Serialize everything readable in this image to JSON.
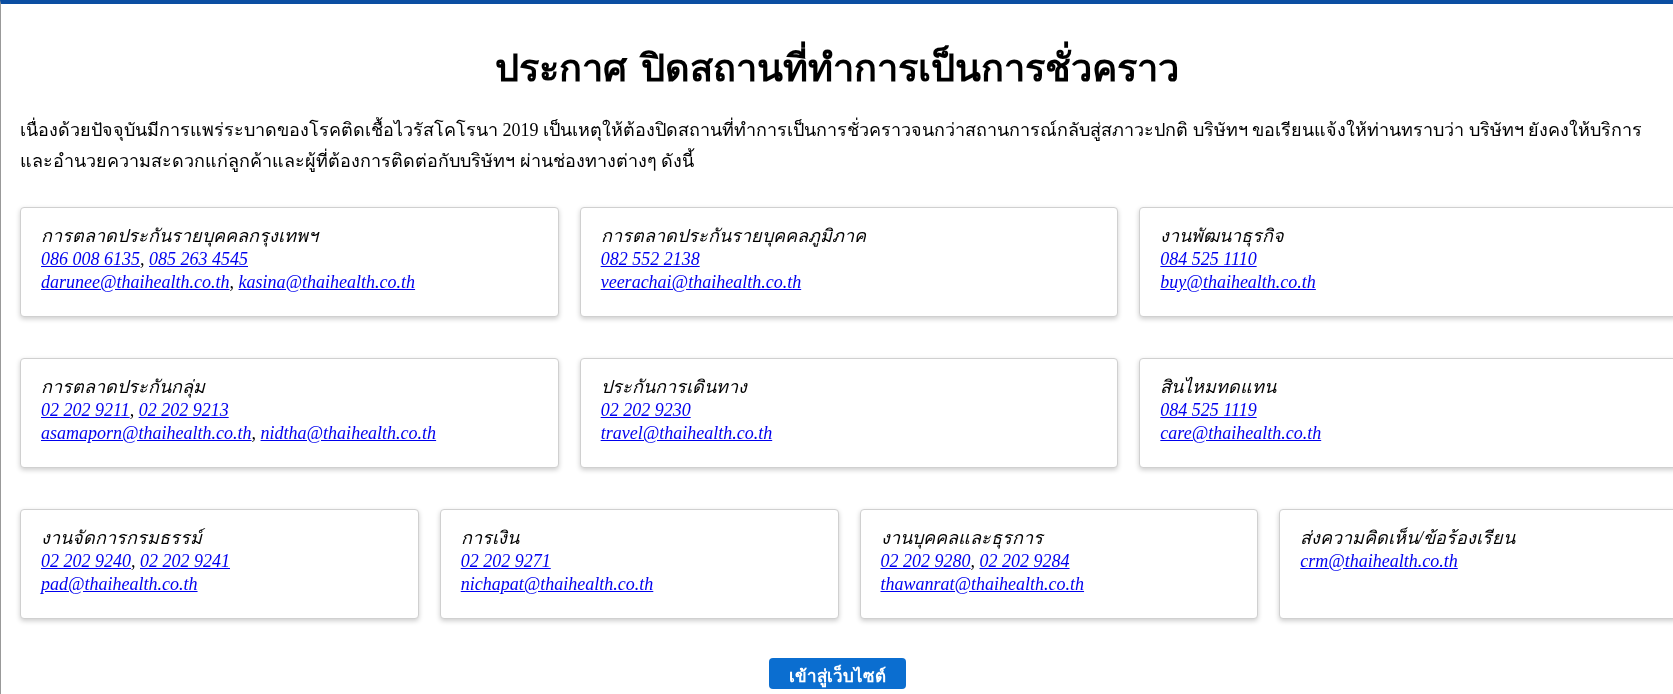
{
  "title": "ประกาศ ปิดสถานที่ทำการเป็นการชั่วคราว",
  "intro": "เนื่องด้วยปัจจุบันมีการแพร่ระบาดของโรคติดเชื้อไวรัสโคโรนา 2019 เป็นเหตุให้ต้องปิดสถานที่ทำการเป็นการชั่วคราวจนกว่าสถานการณ์กลับสู่สภาวะปกติ บริษัทฯ ขอเรียนแจ้งให้ท่านทราบว่า บริษัทฯ ยังคงให้บริการและอำนวยความสะดวกแก่ลูกค้าและผู้ที่ต้องการติดต่อกับบริษัทฯ ผ่านช่องทางต่างๆ ดังนี้",
  "card_rows": [
    [
      {
        "name": "การตลาดประกันรายบุคคลกรุงเทพฯ",
        "phones": [
          "086 008 6135",
          "085 263 4545"
        ],
        "phone_separator": ",",
        "emails": [
          "darunee@thaihealth.co.th",
          "kasina@thaihealth.co.th"
        ],
        "email_separator": ","
      },
      {
        "name": "การตลาดประกันรายบุคคลภูมิภาค",
        "phones": [
          "082 552 2138"
        ],
        "emails": [
          "veerachai@thaihealth.co.th"
        ]
      },
      {
        "name": "งานพัฒนาธุรกิจ",
        "phones": [
          "084 525 1110"
        ],
        "emails": [
          "buy@thaihealth.co.th"
        ]
      }
    ],
    [
      {
        "name": "การตลาดประกันกลุ่ม",
        "phones": [
          "02 202 9211",
          "02 202 9213"
        ],
        "phone_separator": ",",
        "emails": [
          "asamaporn@thaihealth.co.th",
          "nidtha@thaihealth.co.th"
        ],
        "email_separator": ","
      },
      {
        "name": "ประกันการเดินทาง",
        "phones": [
          "02 202 9230"
        ],
        "emails": [
          "travel@thaihealth.co.th"
        ]
      },
      {
        "name": "สินไหมทดแทน",
        "phones": [
          "084 525 1119"
        ],
        "emails": [
          "care@thaihealth.co.th"
        ]
      }
    ],
    [
      {
        "name": "งานจัดการกรมธรรม์",
        "phones": [
          "02 202 9240",
          "02 202 9241"
        ],
        "phone_separator": ",",
        "emails": [
          "pad@thaihealth.co.th"
        ]
      },
      {
        "name": "การเงิน",
        "phones": [
          "02 202 9271"
        ],
        "emails": [
          "nichapat@thaihealth.co.th"
        ]
      },
      {
        "name": "งานบุคคลและธุรการ",
        "phones": [
          "02 202 9280",
          "02 202 9284"
        ],
        "phone_separator": ",",
        "emails": [
          "thawanrat@thaihealth.co.th"
        ]
      },
      {
        "name": "ส่งความคิดเห็น/ข้อร้องเรียน",
        "emails": [
          "crm@thaihealth.co.th"
        ]
      }
    ]
  ],
  "enter_button": "เข้าสู่เว็บไซต์"
}
